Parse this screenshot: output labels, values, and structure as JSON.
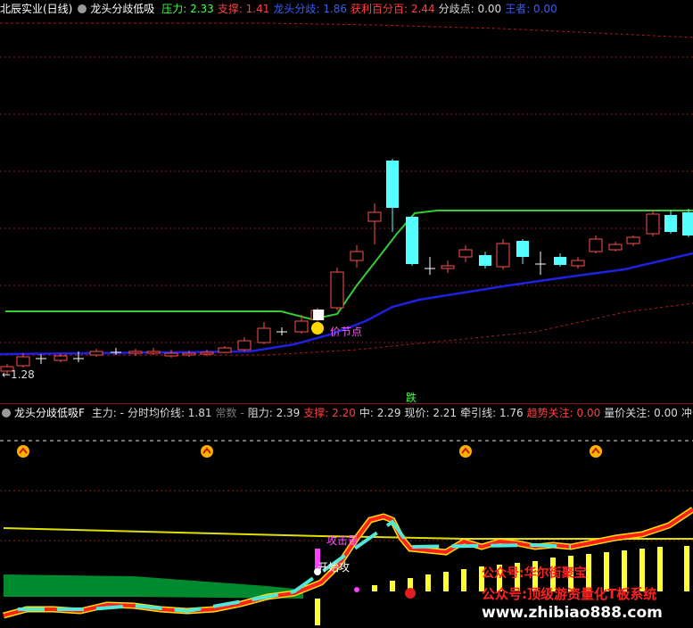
{
  "main_panel": {
    "stock_name": "北辰实业(日线)",
    "indicator_name": "龙头分歧低吸",
    "fields": [
      {
        "label": "压力:",
        "value": "2.33",
        "color": "#44ff44"
      },
      {
        "label": "支撑:",
        "value": "1.41",
        "color": "#ff4040"
      },
      {
        "label": "龙头分歧:",
        "value": "1.86",
        "color": "#3b5bff"
      },
      {
        "label": "获利百分百:",
        "value": "2.44",
        "color": "#ff4040"
      },
      {
        "label": "分歧点:",
        "value": "0.00",
        "color": "#dcdcdc"
      },
      {
        "label": "王者:",
        "value": "0.00",
        "color": "#3b5bff"
      }
    ],
    "price_label": "←1.28",
    "node_label": "价节点",
    "bottom_mark": "跌"
  },
  "sub_panel": {
    "indicator_name": "龙头分歧低吸F",
    "fields": [
      {
        "label": "主力:",
        "value": "-",
        "color": "#dcdcdc"
      },
      {
        "label": "分时均价线:",
        "value": "1.81",
        "color": "#dcdcdc"
      },
      {
        "label": "常数",
        "value": "-",
        "color": "#7a7a7a"
      },
      {
        "label": "阻力:",
        "value": "2.39",
        "color": "#dcdcdc"
      },
      {
        "label": "支撑:",
        "value": "2.20",
        "color": "#ff4040"
      },
      {
        "label": "中:",
        "value": "2.29",
        "color": "#dcdcdc"
      },
      {
        "label": "现价:",
        "value": "2.21",
        "color": "#dcdcdc"
      },
      {
        "label": "牵引线:",
        "value": "1.76",
        "color": "#dcdcdc"
      },
      {
        "label": "趋势关注:",
        "value": "0.00",
        "color": "#ff4040"
      },
      {
        "label": "量价关注:",
        "value": "0.00",
        "color": "#dcdcdc"
      },
      {
        "label": "冲击量:",
        "value": "",
        "color": "#dcdcdc"
      }
    ],
    "attack_volume_label": "攻击量",
    "attack_label": "开始攻"
  },
  "watermarks": {
    "line1": "公众号:华尔街聚宝",
    "line2": "公众号:顶级游资量化T板系统",
    "line3": "www.zhibiao888.com"
  },
  "colors": {
    "upper_line": "#33cc33",
    "lower_line": "#2020e0",
    "bull": "#ff5050",
    "bear": "#55ffff",
    "grid": "#8a1a1a",
    "watermark": "#ff2020",
    "watermark_url": "#ffffff"
  }
}
